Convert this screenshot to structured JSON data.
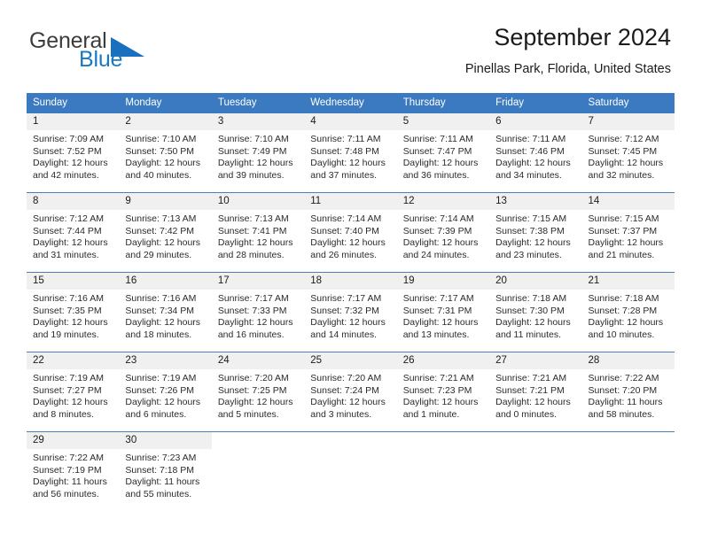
{
  "brand": {
    "name_part1": "General",
    "name_part2": "Blue",
    "triangle_color": "#1a6fbe"
  },
  "header": {
    "title": "September 2024",
    "subtitle": "Pinellas Park, Florida, United States",
    "header_bg_color": "#3b7ac0",
    "daynum_bg_color": "#f0f0f0",
    "row_divider_color": "#4a7ebb"
  },
  "weekdays": [
    "Sunday",
    "Monday",
    "Tuesday",
    "Wednesday",
    "Thursday",
    "Friday",
    "Saturday"
  ],
  "weeks": [
    [
      {
        "day": "1",
        "sunrise": "Sunrise: 7:09 AM",
        "sunset": "Sunset: 7:52 PM",
        "daylight_line1": "Daylight: 12 hours",
        "daylight_line2": "and 42 minutes."
      },
      {
        "day": "2",
        "sunrise": "Sunrise: 7:10 AM",
        "sunset": "Sunset: 7:50 PM",
        "daylight_line1": "Daylight: 12 hours",
        "daylight_line2": "and 40 minutes."
      },
      {
        "day": "3",
        "sunrise": "Sunrise: 7:10 AM",
        "sunset": "Sunset: 7:49 PM",
        "daylight_line1": "Daylight: 12 hours",
        "daylight_line2": "and 39 minutes."
      },
      {
        "day": "4",
        "sunrise": "Sunrise: 7:11 AM",
        "sunset": "Sunset: 7:48 PM",
        "daylight_line1": "Daylight: 12 hours",
        "daylight_line2": "and 37 minutes."
      },
      {
        "day": "5",
        "sunrise": "Sunrise: 7:11 AM",
        "sunset": "Sunset: 7:47 PM",
        "daylight_line1": "Daylight: 12 hours",
        "daylight_line2": "and 36 minutes."
      },
      {
        "day": "6",
        "sunrise": "Sunrise: 7:11 AM",
        "sunset": "Sunset: 7:46 PM",
        "daylight_line1": "Daylight: 12 hours",
        "daylight_line2": "and 34 minutes."
      },
      {
        "day": "7",
        "sunrise": "Sunrise: 7:12 AM",
        "sunset": "Sunset: 7:45 PM",
        "daylight_line1": "Daylight: 12 hours",
        "daylight_line2": "and 32 minutes."
      }
    ],
    [
      {
        "day": "8",
        "sunrise": "Sunrise: 7:12 AM",
        "sunset": "Sunset: 7:44 PM",
        "daylight_line1": "Daylight: 12 hours",
        "daylight_line2": "and 31 minutes."
      },
      {
        "day": "9",
        "sunrise": "Sunrise: 7:13 AM",
        "sunset": "Sunset: 7:42 PM",
        "daylight_line1": "Daylight: 12 hours",
        "daylight_line2": "and 29 minutes."
      },
      {
        "day": "10",
        "sunrise": "Sunrise: 7:13 AM",
        "sunset": "Sunset: 7:41 PM",
        "daylight_line1": "Daylight: 12 hours",
        "daylight_line2": "and 28 minutes."
      },
      {
        "day": "11",
        "sunrise": "Sunrise: 7:14 AM",
        "sunset": "Sunset: 7:40 PM",
        "daylight_line1": "Daylight: 12 hours",
        "daylight_line2": "and 26 minutes."
      },
      {
        "day": "12",
        "sunrise": "Sunrise: 7:14 AM",
        "sunset": "Sunset: 7:39 PM",
        "daylight_line1": "Daylight: 12 hours",
        "daylight_line2": "and 24 minutes."
      },
      {
        "day": "13",
        "sunrise": "Sunrise: 7:15 AM",
        "sunset": "Sunset: 7:38 PM",
        "daylight_line1": "Daylight: 12 hours",
        "daylight_line2": "and 23 minutes."
      },
      {
        "day": "14",
        "sunrise": "Sunrise: 7:15 AM",
        "sunset": "Sunset: 7:37 PM",
        "daylight_line1": "Daylight: 12 hours",
        "daylight_line2": "and 21 minutes."
      }
    ],
    [
      {
        "day": "15",
        "sunrise": "Sunrise: 7:16 AM",
        "sunset": "Sunset: 7:35 PM",
        "daylight_line1": "Daylight: 12 hours",
        "daylight_line2": "and 19 minutes."
      },
      {
        "day": "16",
        "sunrise": "Sunrise: 7:16 AM",
        "sunset": "Sunset: 7:34 PM",
        "daylight_line1": "Daylight: 12 hours",
        "daylight_line2": "and 18 minutes."
      },
      {
        "day": "17",
        "sunrise": "Sunrise: 7:17 AM",
        "sunset": "Sunset: 7:33 PM",
        "daylight_line1": "Daylight: 12 hours",
        "daylight_line2": "and 16 minutes."
      },
      {
        "day": "18",
        "sunrise": "Sunrise: 7:17 AM",
        "sunset": "Sunset: 7:32 PM",
        "daylight_line1": "Daylight: 12 hours",
        "daylight_line2": "and 14 minutes."
      },
      {
        "day": "19",
        "sunrise": "Sunrise: 7:17 AM",
        "sunset": "Sunset: 7:31 PM",
        "daylight_line1": "Daylight: 12 hours",
        "daylight_line2": "and 13 minutes."
      },
      {
        "day": "20",
        "sunrise": "Sunrise: 7:18 AM",
        "sunset": "Sunset: 7:30 PM",
        "daylight_line1": "Daylight: 12 hours",
        "daylight_line2": "and 11 minutes."
      },
      {
        "day": "21",
        "sunrise": "Sunrise: 7:18 AM",
        "sunset": "Sunset: 7:28 PM",
        "daylight_line1": "Daylight: 12 hours",
        "daylight_line2": "and 10 minutes."
      }
    ],
    [
      {
        "day": "22",
        "sunrise": "Sunrise: 7:19 AM",
        "sunset": "Sunset: 7:27 PM",
        "daylight_line1": "Daylight: 12 hours",
        "daylight_line2": "and 8 minutes."
      },
      {
        "day": "23",
        "sunrise": "Sunrise: 7:19 AM",
        "sunset": "Sunset: 7:26 PM",
        "daylight_line1": "Daylight: 12 hours",
        "daylight_line2": "and 6 minutes."
      },
      {
        "day": "24",
        "sunrise": "Sunrise: 7:20 AM",
        "sunset": "Sunset: 7:25 PM",
        "daylight_line1": "Daylight: 12 hours",
        "daylight_line2": "and 5 minutes."
      },
      {
        "day": "25",
        "sunrise": "Sunrise: 7:20 AM",
        "sunset": "Sunset: 7:24 PM",
        "daylight_line1": "Daylight: 12 hours",
        "daylight_line2": "and 3 minutes."
      },
      {
        "day": "26",
        "sunrise": "Sunrise: 7:21 AM",
        "sunset": "Sunset: 7:23 PM",
        "daylight_line1": "Daylight: 12 hours",
        "daylight_line2": "and 1 minute."
      },
      {
        "day": "27",
        "sunrise": "Sunrise: 7:21 AM",
        "sunset": "Sunset: 7:21 PM",
        "daylight_line1": "Daylight: 12 hours",
        "daylight_line2": "and 0 minutes."
      },
      {
        "day": "28",
        "sunrise": "Sunrise: 7:22 AM",
        "sunset": "Sunset: 7:20 PM",
        "daylight_line1": "Daylight: 11 hours",
        "daylight_line2": "and 58 minutes."
      }
    ],
    [
      {
        "day": "29",
        "sunrise": "Sunrise: 7:22 AM",
        "sunset": "Sunset: 7:19 PM",
        "daylight_line1": "Daylight: 11 hours",
        "daylight_line2": "and 56 minutes."
      },
      {
        "day": "30",
        "sunrise": "Sunrise: 7:23 AM",
        "sunset": "Sunset: 7:18 PM",
        "daylight_line1": "Daylight: 11 hours",
        "daylight_line2": "and 55 minutes."
      },
      {
        "day": "",
        "sunrise": "",
        "sunset": "",
        "daylight_line1": "",
        "daylight_line2": ""
      },
      {
        "day": "",
        "sunrise": "",
        "sunset": "",
        "daylight_line1": "",
        "daylight_line2": ""
      },
      {
        "day": "",
        "sunrise": "",
        "sunset": "",
        "daylight_line1": "",
        "daylight_line2": ""
      },
      {
        "day": "",
        "sunrise": "",
        "sunset": "",
        "daylight_line1": "",
        "daylight_line2": ""
      },
      {
        "day": "",
        "sunrise": "",
        "sunset": "",
        "daylight_line1": "",
        "daylight_line2": ""
      }
    ]
  ]
}
